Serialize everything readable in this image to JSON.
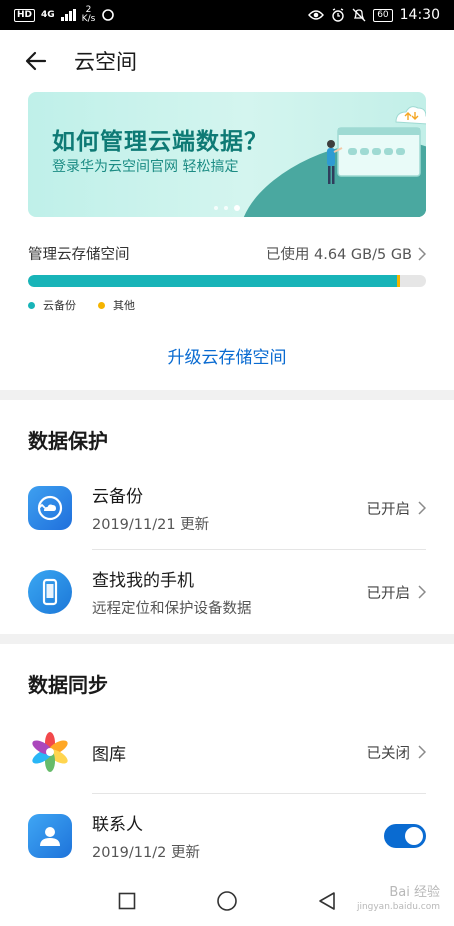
{
  "status_bar": {
    "hd": "HD",
    "network": "4G",
    "speed_value": "2",
    "speed_unit": "K/s",
    "battery": "60",
    "time": "14:30"
  },
  "header": {
    "title": "云空间"
  },
  "banner": {
    "title": "如何管理云端数据？",
    "subtitle": "登录华为云空间官网  轻松搞定",
    "active_dot": 2
  },
  "storage": {
    "label": "管理云存储空间",
    "used_text": "已使用 4.64 GB/5 GB",
    "backup_fraction": 0.928,
    "other_fraction": 0.006,
    "legend": [
      {
        "label": "云备份",
        "color": "#18b4b8"
      },
      {
        "label": "其他",
        "color": "#f5b400"
      }
    ],
    "upgrade_label": "升级云存储空间"
  },
  "data_protection": {
    "title": "数据保护",
    "items": [
      {
        "name": "云备份",
        "sub": "2019/11/21 更新",
        "status": "已开启",
        "icon": "cloud-backup-icon"
      },
      {
        "name": "查找我的手机",
        "sub": "远程定位和保护设备数据",
        "status": "已开启",
        "icon": "find-phone-icon"
      }
    ]
  },
  "data_sync": {
    "title": "数据同步",
    "items": [
      {
        "name": "图库",
        "status": "已关闭",
        "icon": "gallery-icon"
      },
      {
        "name": "联系人",
        "sub": "2019/11/2 更新",
        "toggle_on": true,
        "icon": "contacts-icon"
      }
    ]
  },
  "watermark": {
    "line1": "Bai 经验",
    "line2": "jingyan.baidu.com"
  }
}
